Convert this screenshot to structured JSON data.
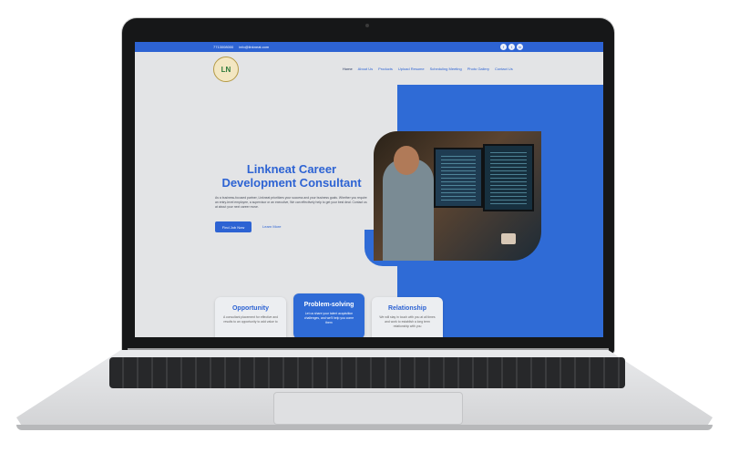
{
  "topbar": {
    "phone": "7713008000",
    "email": "info@linkneat.com",
    "social_icons": [
      "facebook-icon",
      "twitter-icon",
      "linkedin-icon"
    ]
  },
  "logo": {
    "text": "LN"
  },
  "nav": [
    "Home",
    "About Us",
    "Products",
    "Upload Resume",
    "Scheduling Meeting",
    "Photo Gallery",
    "Contact Us"
  ],
  "hero": {
    "title": "Linkneat Career Development Consultant",
    "description": "As a business-focused partner, Linkneat prioritizes your success and your business goals. Whether you require an entry-level employee, a supervisor or an executive, We can effectively help to get your best deal. Contact us at about your next career move.",
    "primary_button": "Find Job Now",
    "secondary_link": "Learn More"
  },
  "cards": [
    {
      "title": "Opportunity",
      "text": "A consultant placement for effective and results to an opportunity to add value to"
    },
    {
      "title": "Problem-solving",
      "text": "Let us share your talent acquisition challenges, and we'll help you come them"
    },
    {
      "title": "Relationship",
      "text": "We will stay in touch with you at all times and work to establish a long term relationship with you"
    }
  ],
  "colors": {
    "accent": "#2d63d3",
    "panel": "#2f6bd6"
  }
}
